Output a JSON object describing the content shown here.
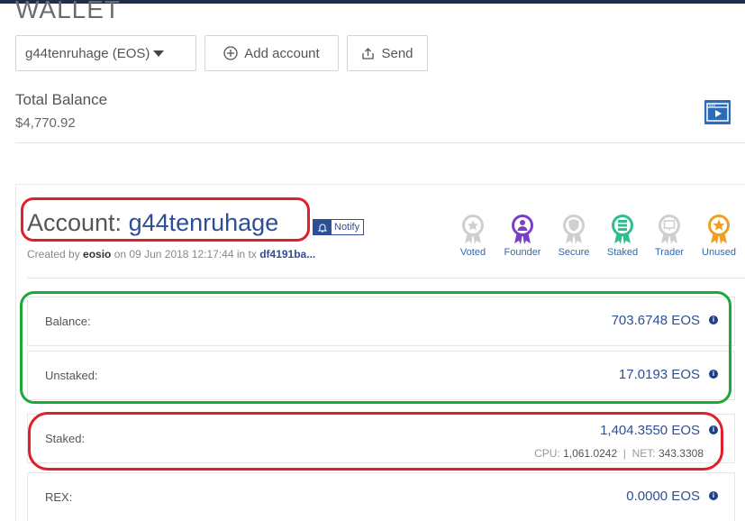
{
  "header": {
    "title": "WALLET",
    "account_selector": "g44tenruhage (EOS)",
    "add_account_label": "Add account",
    "send_label": "Send"
  },
  "summary": {
    "total_label": "Total Balance",
    "total_value": "$4,770.92"
  },
  "account": {
    "prefix": "Account: ",
    "name": "g44tenruhage",
    "notify_label": "Notify",
    "created_by_text": "Created by ",
    "creator": "eosio",
    "on_text": " on ",
    "created_date": "09 Jun 2018 12:17:44",
    "in_tx_text": " in tx ",
    "tx": "df4191ba..."
  },
  "badges": [
    {
      "label": "Voted",
      "color": "#cfcfcf",
      "icon": "vote-icon"
    },
    {
      "label": "Founder",
      "color": "#7b3fc7",
      "icon": "founder-icon"
    },
    {
      "label": "Secure",
      "color": "#cfcfcf",
      "icon": "shield-icon"
    },
    {
      "label": "Staked",
      "color": "#2fbf8f",
      "icon": "stack-icon"
    },
    {
      "label": "Trader",
      "color": "#cfcfcf",
      "icon": "trader-icon"
    },
    {
      "label": "Unused",
      "color": "#f0a020",
      "icon": "star-icon"
    }
  ],
  "balances": {
    "balance": {
      "label": "Balance:",
      "value": "703.6748 EOS"
    },
    "unstaked": {
      "label": "Unstaked:",
      "value": "17.0193 EOS"
    },
    "staked": {
      "label": "Staked:",
      "value": "1,404.3550 EOS",
      "cpu_label": "CPU: ",
      "cpu_value": "1,061.0242",
      "separator": "  |  ",
      "net_label": "NET: ",
      "net_value": "343.3308"
    },
    "rex": {
      "label": "REX:",
      "value": "0.0000 EOS"
    }
  },
  "colors": {
    "accent": "#2e4f94",
    "highlight_red": "#e11f2a",
    "highlight_green": "#1fa83a"
  }
}
